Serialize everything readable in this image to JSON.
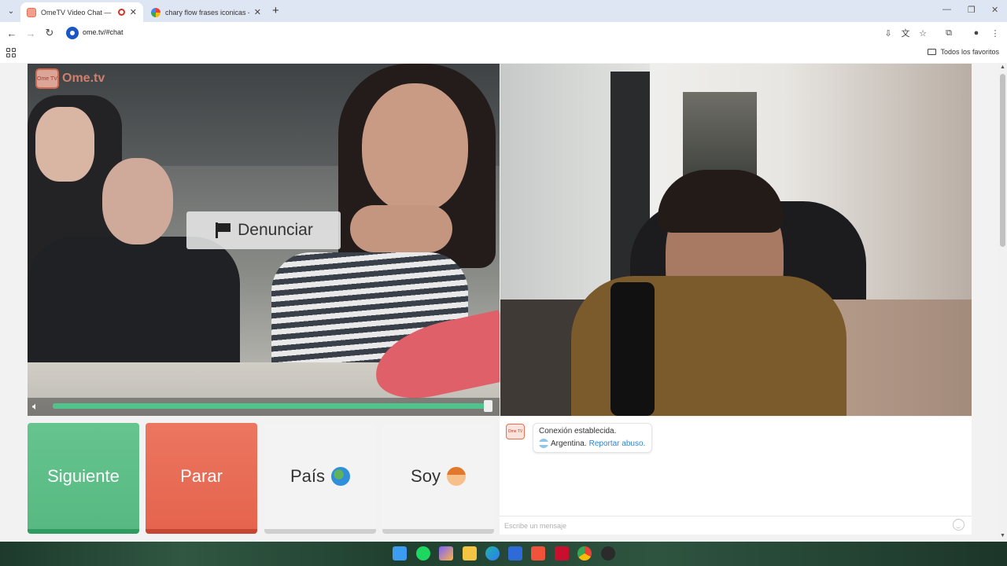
{
  "browser": {
    "tabs": [
      {
        "title": "OmeTV Video Chat — Ome",
        "active": true
      },
      {
        "title": "chary flow frases iconicas - Bu",
        "active": false
      }
    ],
    "url": "ome.tv/#chat",
    "bookmarks_label": "Todos los favoritos"
  },
  "page": {
    "logo_text": "Ome.tv",
    "logo_badge": "Ome TV",
    "report_label": "Denunciar",
    "volume_level": 1.0,
    "buttons": {
      "next": "Siguiente",
      "stop": "Parar",
      "country": "País",
      "gender": "Soy"
    },
    "chat": {
      "connection_text": "Conexión establecida.",
      "country": "Argentina.",
      "report_abuse": "Reportar abuso.",
      "input_placeholder": "Escribe un mensaje"
    }
  },
  "icons": [
    "ome-tv-logo",
    "flag-icon",
    "speaker-icon",
    "globe-icon",
    "boy-icon",
    "argentina-flag-icon",
    "emoji-icon"
  ],
  "colors": {
    "next_button": "#5dbf87",
    "stop_button": "#e96b55",
    "volume_fill": "#4fc38b",
    "link": "#2a86d8"
  }
}
